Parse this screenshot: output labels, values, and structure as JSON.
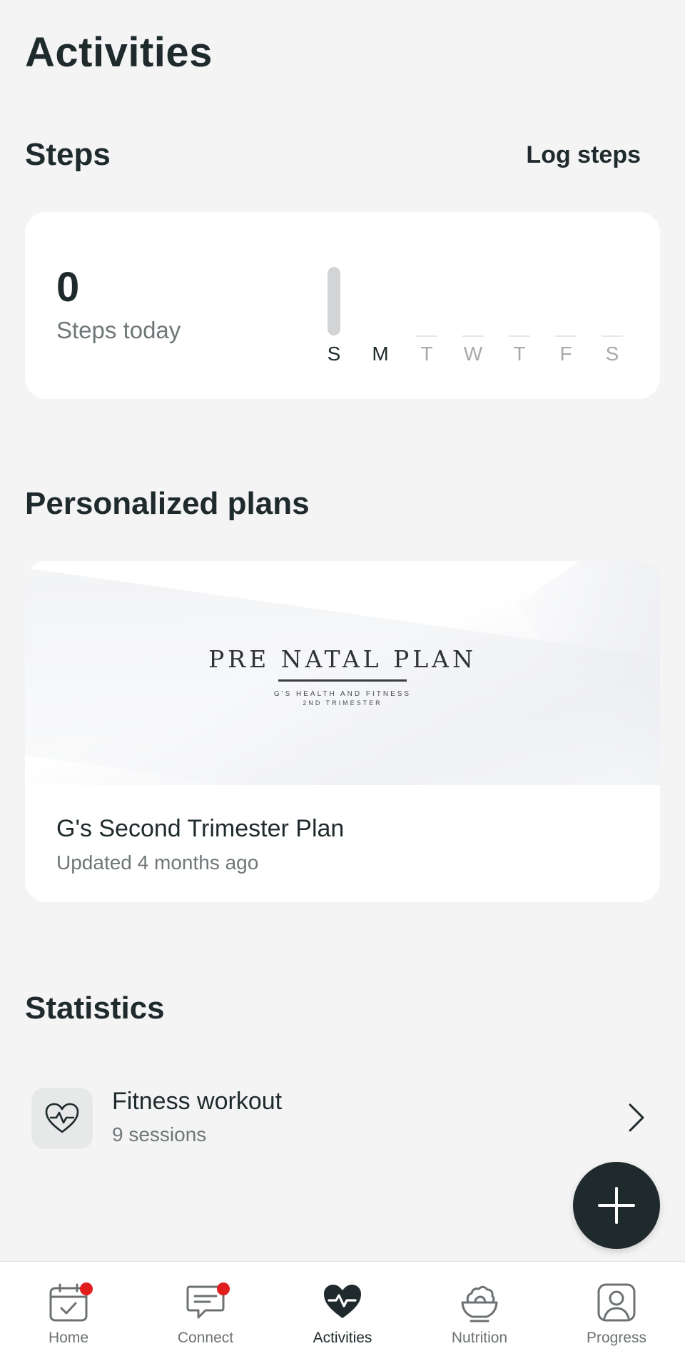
{
  "page": {
    "title": "Activities"
  },
  "steps": {
    "title": "Steps",
    "log_label": "Log steps",
    "count": "0",
    "label": "Steps today",
    "days": [
      "S",
      "M",
      "T",
      "W",
      "T",
      "F",
      "S"
    ],
    "active_day_index": 0
  },
  "plans": {
    "title": "Personalized plans",
    "items": [
      {
        "banner_title": "PRE NATAL PLAN",
        "banner_subtitle": "G'S HEALTH AND FITNESS",
        "banner_subtitle2": "2ND TRIMESTER",
        "name": "G's Second Trimester Plan",
        "updated": "Updated 4 months ago"
      }
    ]
  },
  "statistics": {
    "title": "Statistics",
    "items": [
      {
        "icon": "heart-pulse-icon",
        "title": "Fitness workout",
        "subtitle": "9 sessions"
      }
    ]
  },
  "fab": {
    "icon": "plus-icon"
  },
  "nav": {
    "items": [
      {
        "label": "Home",
        "icon": "calendar-check-icon",
        "badge": true
      },
      {
        "label": "Connect",
        "icon": "chat-bubble-icon",
        "badge": true
      },
      {
        "label": "Activities",
        "icon": "heart-pulse-icon",
        "active": true
      },
      {
        "label": "Nutrition",
        "icon": "food-bowl-icon"
      },
      {
        "label": "Progress",
        "icon": "person-frame-icon"
      }
    ]
  },
  "colors": {
    "primary": "#1f2a2c",
    "background": "#f4f4f5",
    "badge": "#e11d1d",
    "muted": "#707779"
  }
}
